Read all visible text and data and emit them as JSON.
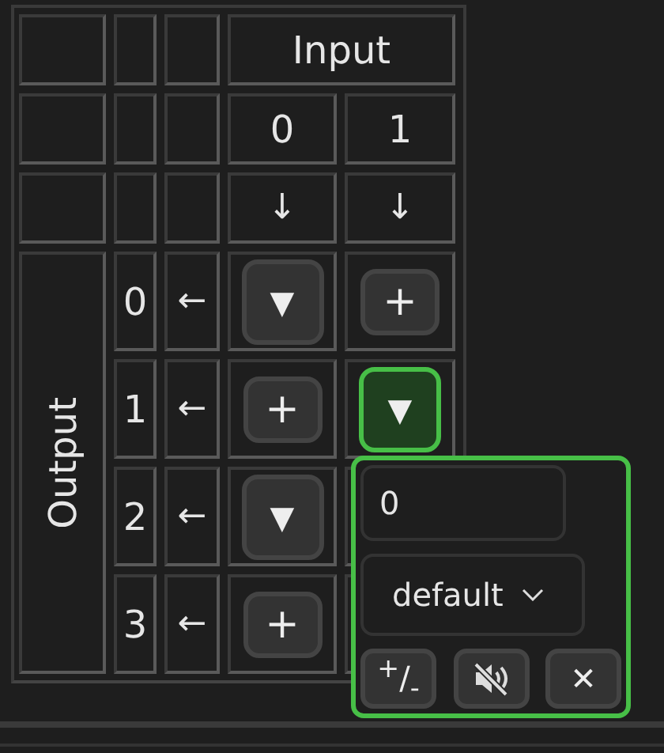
{
  "header": {
    "input_label": "Input",
    "output_label": "Output"
  },
  "inputs": [
    {
      "label": "0",
      "arrow": "↓"
    },
    {
      "label": "1",
      "arrow": "↓"
    }
  ],
  "outputs": [
    {
      "label": "0",
      "arrow": "←",
      "cells": [
        {
          "kind": "gain",
          "label": "▼",
          "selected": false
        },
        {
          "kind": "add",
          "label": "+",
          "selected": false
        }
      ]
    },
    {
      "label": "1",
      "arrow": "←",
      "cells": [
        {
          "kind": "add",
          "label": "+",
          "selected": false
        },
        {
          "kind": "gain",
          "label": "▼",
          "selected": true
        }
      ]
    },
    {
      "label": "2",
      "arrow": "←",
      "cells": [
        {
          "kind": "gain",
          "label": "▼",
          "selected": false
        }
      ]
    },
    {
      "label": "3",
      "arrow": "←",
      "cells": [
        {
          "kind": "add",
          "label": "+",
          "selected": false
        }
      ]
    }
  ],
  "popup": {
    "value": "0",
    "mode": "default",
    "buttons": [
      {
        "kind": "text",
        "label": "$^{+}$/$_{-}$"
      },
      {
        "kind": "mute"
      },
      {
        "kind": "text",
        "label": "✕"
      }
    ]
  }
}
